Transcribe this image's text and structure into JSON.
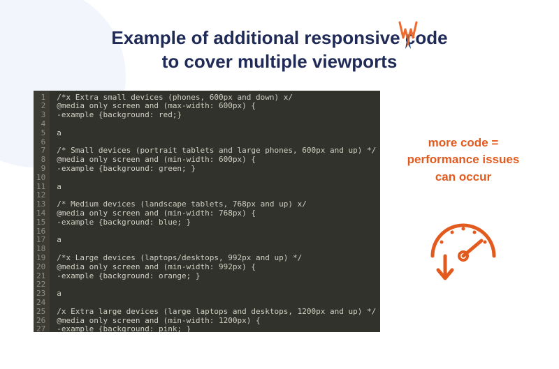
{
  "heading": {
    "line1": "Example of additional responsive code",
    "line2": "to cover multiple viewports"
  },
  "side": {
    "line1": "more code =",
    "line2": "performance issues",
    "line3": "can occur"
  },
  "code": {
    "lines": [
      "/*x Extra small devices (phones, 600px and down) x/",
      "@media only screen and (max-width: 600px) {",
      "-example {background: red;}",
      "",
      "a",
      "",
      "/* Small devices (portrait tablets and large phones, 600px and up) */",
      "@media only screen and (min-width: 600px) {",
      "-example {background: green; }",
      "",
      "a",
      "",
      "/* Medium devices (landscape tablets, 768px and up) x/",
      "@media only screen and (min-width: 768px) {",
      "-example {background: blue; }",
      "",
      "a",
      "",
      "/*x Large devices (laptops/desktops, 992px and up) */",
      "@media only screen and (min-width: 992px) {",
      "-example {background: orange; }",
      "",
      "a",
      "",
      "/x Extra large devices (large laptops and desktops, 1200px and up) */",
      "@media only screen and (min-width: 1200px) {",
      "-example {background: pink; }"
    ]
  },
  "colors": {
    "heading": "#1f2a57",
    "accent": "#e25a1e",
    "code_bg": "#32322c",
    "gutter_bg": "#3c3c34"
  }
}
